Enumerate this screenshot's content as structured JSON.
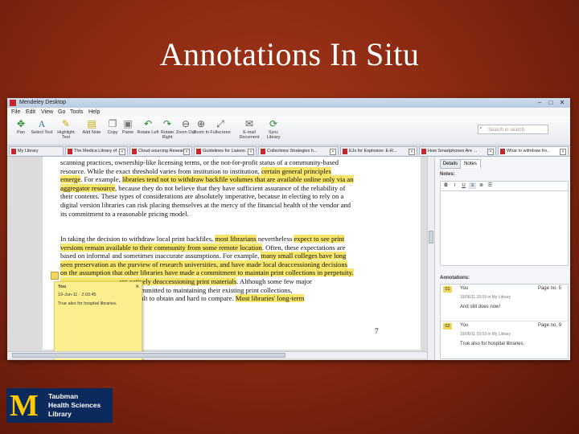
{
  "slide": {
    "title": "Annotations In Situ"
  },
  "window": {
    "title": "Mendeley Desktop",
    "min": "–",
    "max": "□",
    "close": "✕"
  },
  "menu": [
    "File",
    "Edit",
    "View",
    "Go",
    "Tools",
    "Help"
  ],
  "toolbar": [
    {
      "label": "Pan",
      "icon": "hand-icon",
      "glyph": "✥"
    },
    {
      "label": "Select Text",
      "icon": "text-select-icon",
      "glyph": "A"
    },
    {
      "label": "Highlight Text",
      "icon": "highlighter-icon",
      "glyph": "✎"
    },
    {
      "label": "Add Note",
      "icon": "note-icon",
      "glyph": "▤"
    },
    {
      "label": "Copy",
      "icon": "copy-icon",
      "glyph": "❐"
    },
    {
      "label": "Paste",
      "icon": "paste-icon",
      "glyph": "▣"
    },
    {
      "label": "Rotate Left",
      "icon": "rotate-left-icon",
      "glyph": "↶"
    },
    {
      "label": "Rotate Right",
      "icon": "rotate-right-icon",
      "glyph": "↷"
    },
    {
      "label": "Zoom Out",
      "icon": "zoom-out-icon",
      "glyph": "⊖"
    },
    {
      "label": "Zoom In",
      "icon": "zoom-in-icon",
      "glyph": "⊕"
    },
    {
      "label": "Fullscreen",
      "icon": "fullscreen-icon",
      "glyph": "⤢"
    },
    {
      "label": "E-mail Document",
      "icon": "email-icon",
      "glyph": "✉"
    },
    {
      "label": "Sync Library",
      "icon": "sync-icon",
      "glyph": "⟳"
    }
  ],
  "search": {
    "placeholder": "Search in search"
  },
  "tabs": [
    "My Library",
    "The Medica Library of ...",
    "Cloud-sourcing Resear...",
    "Guidelines for Liaison ...",
    "Collections Strategies h...",
    "EJs for Explosion: E-R...",
    "How Smartphones Are ...",
    "What to withdraw fro..."
  ],
  "document": {
    "para1": [
      {
        "t": "scanning practices, ownership-like licensing terms, or the not-for-profit status of a community-based",
        "h": false
      },
      {
        "t": "resource. While the exact threshold varies from institution to institution, ",
        "h": false,
        "t2": "certain general principles",
        "h2": true
      },
      {
        "t": "emerge",
        "h": true,
        "t2": ". For example, ",
        "h2": false,
        "t3": "libraries tend not to withdraw backfile volumes that are available online only via an",
        "h3": true
      },
      {
        "t": "aggregator resource",
        "h": true,
        "t2": ", because they do not believe that they have sufficient assurance of the reliability of",
        "h2": false
      },
      {
        "t": "their contents. These types of considerations are absolutely imperative, because in electing to rely on a",
        "h": false
      },
      {
        "t": "digital version libraries can risk placing themselves at the mercy of the financial health of the vendor and",
        "h": false
      },
      {
        "t": "its commitment to a reasonable pricing model.",
        "h": false
      }
    ],
    "para2": [
      {
        "t": "In taking the decision to withdraw local print backfiles, ",
        "h": false,
        "t2": "most librarians",
        "h2": true,
        "t3": " nevertheless ",
        "h3": false,
        "t4": "expect to see print",
        "h4": true
      },
      {
        "t": "versions remain available to their community from some remote location",
        "h": true,
        "t2": ". Often, these expectations are",
        "h2": false
      },
      {
        "t": "based on informal and sometimes inaccurate assumptions. For example, ",
        "h": false,
        "t2": "many small colleges have long",
        "h2": true
      },
      {
        "t": "seen preservation as the purview of research universities, and have made local deaccessioning decisions",
        "h": true
      },
      {
        "t": "on the assumption that other libraries have made a commitment to maintain print collections in perpetuity.",
        "h": true
      },
      {
        "t": "                                  are actively deaccessioning print materials",
        "h": true,
        "t2": ". Although some few major",
        "h2": false
      },
      {
        "t": "                                  nally committed to maintaining their existing print collections,",
        "h": false
      },
      {
        "t": "                                  is difficult to obtain and hard to compare. ",
        "h": false,
        "t2": "Most libraries' long-term",
        "h2": true
      }
    ],
    "page_number": "7"
  },
  "popup_note": {
    "who": "You",
    "when": "19-Jun-11 · 2:03:45",
    "text": "True also for hospital libraries.",
    "close": "×"
  },
  "panel": {
    "tabs": [
      "Details",
      "Notes"
    ],
    "notes_label": "Notes:",
    "format_buttons": [
      "B",
      "I",
      "U",
      "≡",
      "≣",
      "☰"
    ],
    "annotations_label": "Annotations:",
    "annotations": [
      {
        "num": "01",
        "who": "You",
        "page": "Page no. 5",
        "when": "19/06/11 15:59 in My Library",
        "text": "And still does now!"
      },
      {
        "num": "02",
        "who": "You",
        "page": "Page no. 9",
        "when": "19/06/11 15:53 in My Library",
        "text": "True also for hospital libraries."
      }
    ]
  },
  "logo": {
    "mark": "M",
    "line1": "Taubman",
    "line2": "Health Sciences",
    "line3": "Library"
  }
}
